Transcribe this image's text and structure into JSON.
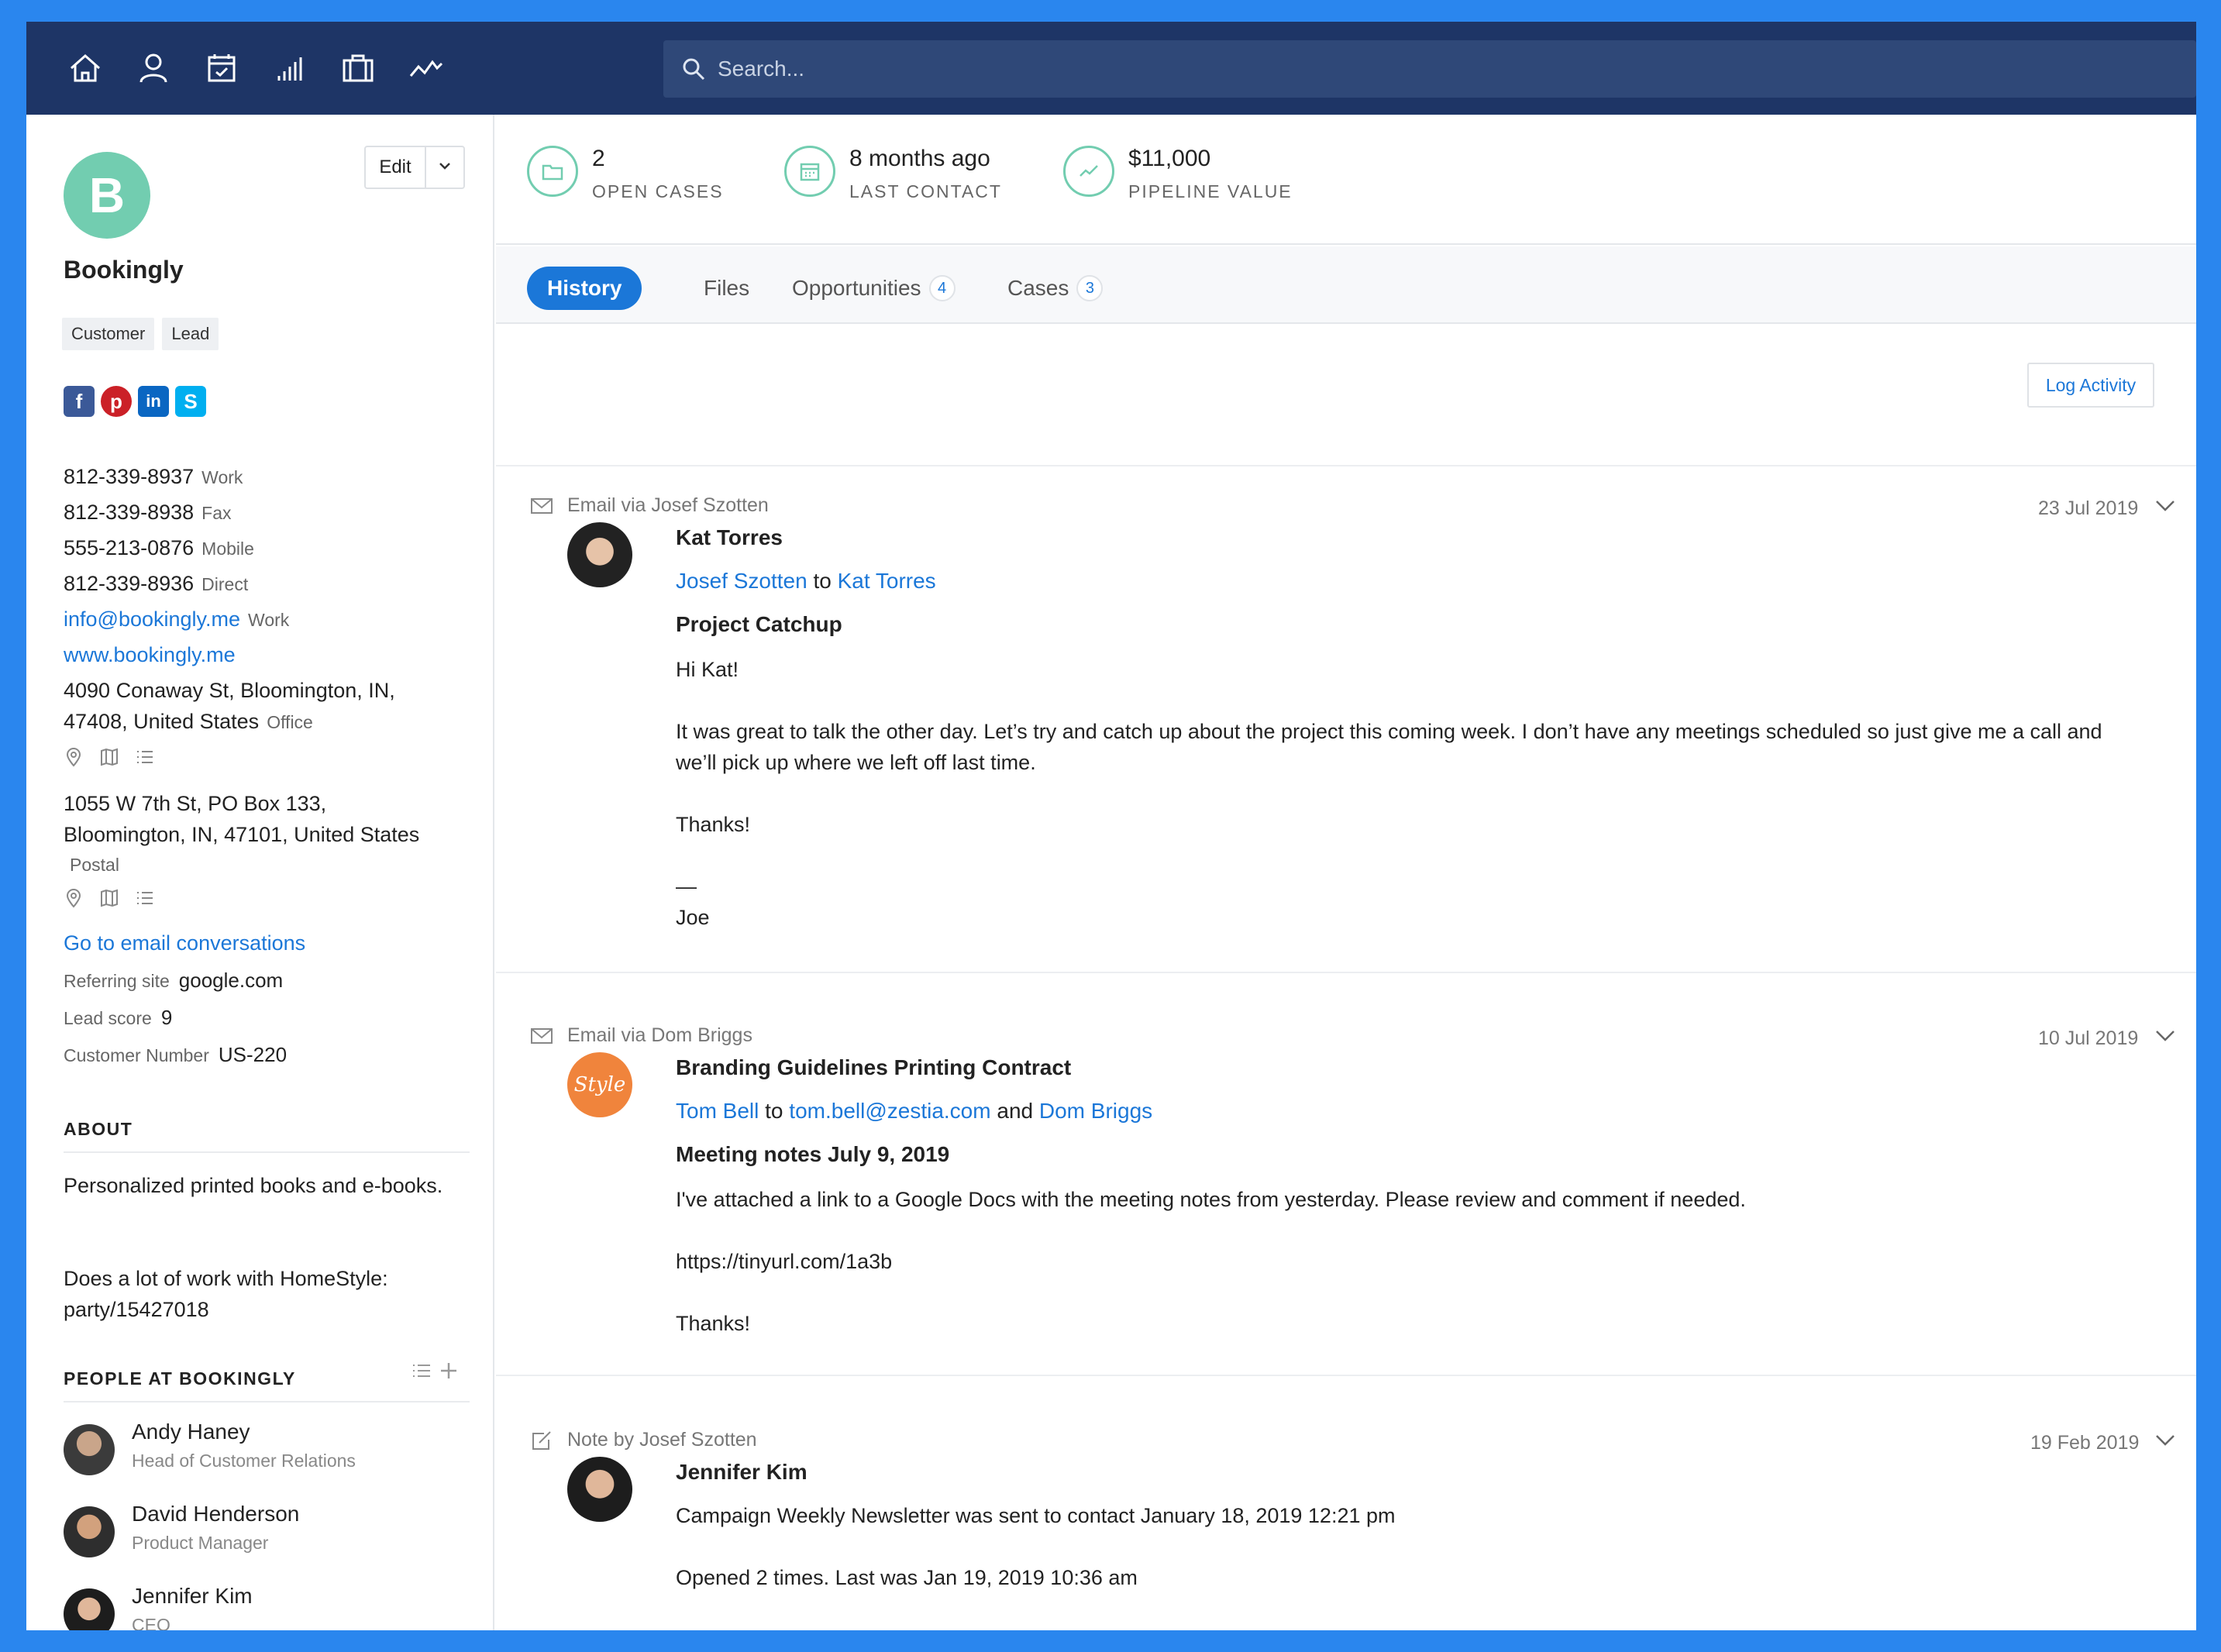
{
  "nav": {
    "icons": [
      "home-icon",
      "person-icon",
      "calendar-icon",
      "bar-chart-icon",
      "briefcase-icon",
      "activity-icon"
    ],
    "search_placeholder": "Search..."
  },
  "sidebar": {
    "avatar_letter": "B",
    "edit_label": "Edit",
    "company_name": "Bookingly",
    "tags": [
      "Customer",
      "Lead"
    ],
    "socials": [
      "facebook-icon",
      "pinterest-icon",
      "linkedin-icon",
      "skype-icon"
    ],
    "phones": [
      {
        "number": "812-339-8937",
        "type": "Work"
      },
      {
        "number": "812-339-8938",
        "type": "Fax"
      },
      {
        "number": "555-213-0876",
        "type": "Mobile"
      },
      {
        "number": "812-339-8936",
        "type": "Direct"
      }
    ],
    "email": {
      "address": "info@bookingly.me",
      "type": "Work"
    },
    "website": "www.bookingly.me",
    "address1": {
      "line1": "4090 Conaway St, Bloomington, IN,",
      "line2": "47408, United States",
      "type": "Office"
    },
    "address2": {
      "line1": "1055 W 7th St, PO Box 133,",
      "line2": "Bloomington, IN, 47101, United States",
      "type": "Postal"
    },
    "email_conversations_link": "Go to email conversations",
    "fields": [
      {
        "label": "Referring site",
        "value": "google.com"
      },
      {
        "label": "Lead score",
        "value": "9"
      },
      {
        "label": "Customer Number",
        "value": "US-220"
      }
    ],
    "about_heading": "ABOUT",
    "about_text": "Personalized printed books and e-books.",
    "about_text2": "Does a lot of work with HomeStyle:",
    "about_link": "party/15427018",
    "people_heading": "PEOPLE AT BOOKINGLY",
    "people": [
      {
        "name": "Andy Haney",
        "role": "Head of Customer Relations"
      },
      {
        "name": "David Henderson",
        "role": "Product Manager"
      },
      {
        "name": "Jennifer Kim",
        "role": "CEO"
      }
    ]
  },
  "stats": [
    {
      "value": "2",
      "label": "OPEN CASES"
    },
    {
      "value": "8 months ago",
      "label": "LAST CONTACT"
    },
    {
      "value": "$11,000",
      "label": "PIPELINE VALUE"
    }
  ],
  "tabs": [
    {
      "label": "History",
      "badge": null
    },
    {
      "label": "Files",
      "badge": null
    },
    {
      "label": "Opportunities",
      "badge": "4"
    },
    {
      "label": "Cases",
      "badge": "3"
    }
  ],
  "log_activity": "Log Activity",
  "entries": [
    {
      "header": "Email via Josef Szotten",
      "date": "23 Jul 2019",
      "contact": "Kat Torres",
      "from": "Josef Szotten",
      "to_word": "to",
      "to": "Kat Torres",
      "subject": "Project Catchup",
      "greeting": "Hi Kat!",
      "body": "It was great to talk the other day. Let’s try and catch up about the project this coming week. I don’t have any meetings scheduled so just give me a call and we’ll pick up where we left off last time.",
      "thanks": "Thanks!",
      "dash": "—",
      "sign": "Joe"
    },
    {
      "header": "Email via Dom Briggs",
      "date": "10 Jul 2019",
      "contact": "Branding Guidelines Printing Contract",
      "avatar_text": "Style",
      "from": "Tom Bell",
      "to_word": "to",
      "to": "tom.bell@zestia.com",
      "and_word": "and",
      "cc": "Dom Briggs",
      "subject": "Meeting notes July 9, 2019",
      "body": "I've attached a link to a Google Docs with the meeting notes from yesterday. Please review and comment if needed.",
      "link": "https://tinyurl.com/1a3b",
      "thanks": "Thanks!"
    },
    {
      "header": "Note by Josef Szotten",
      "date": "19 Feb 2019",
      "contact": "Jennifer Kim",
      "line1": "Campaign Weekly Newsletter was sent to contact January 18, 2019 12:21 pm",
      "line2": "Opened 2 times. Last was Jan 19, 2019 10:36 am"
    }
  ],
  "colors": {
    "frame_blue": "#2a86ee",
    "nav_bg": "#1e3566",
    "accent": "#1b77d8",
    "teal": "#72cdb0",
    "style_orange": "#f0843c"
  }
}
